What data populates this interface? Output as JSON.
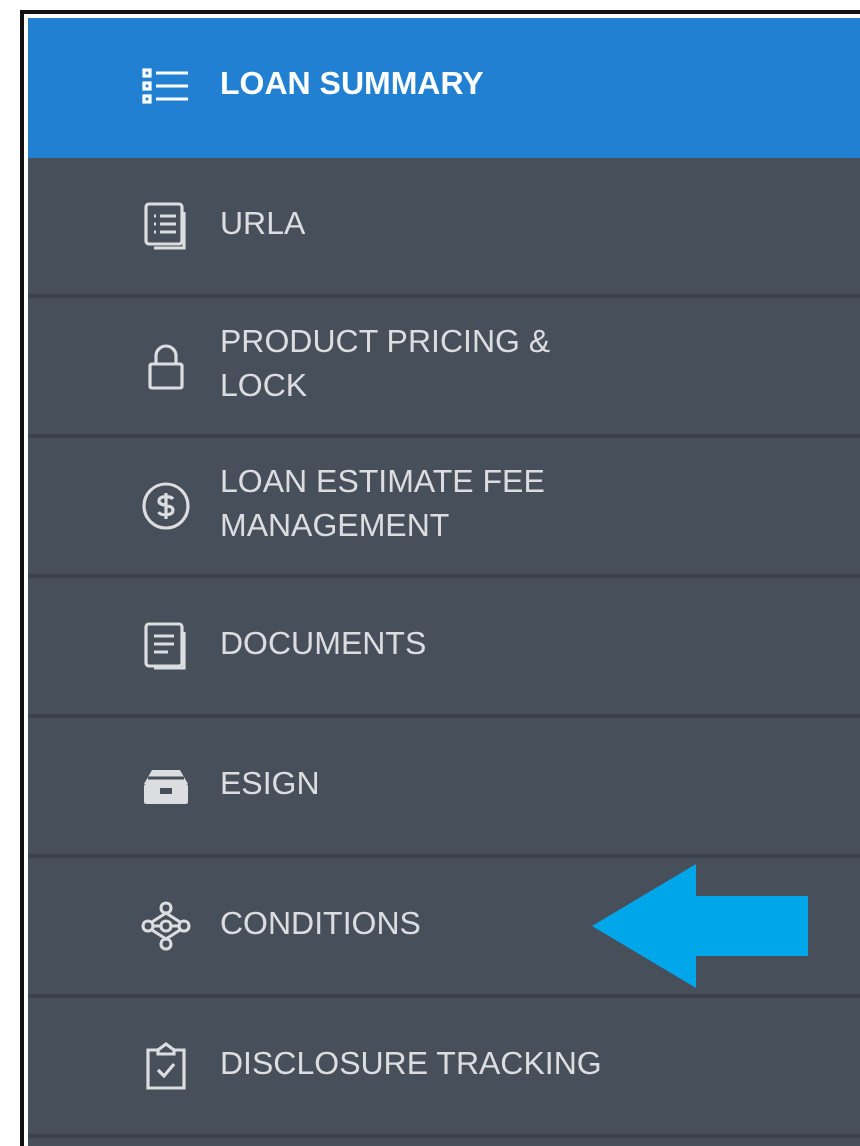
{
  "menu": [
    {
      "label": "LOAN SUMMARY",
      "selected": true,
      "pointed": false
    },
    {
      "label": "URLA",
      "selected": false,
      "pointed": false
    },
    {
      "label": "PRODUCT PRICING & LOCK",
      "selected": false,
      "pointed": false
    },
    {
      "label": "LOAN ESTIMATE FEE MANAGEMENT",
      "selected": false,
      "pointed": false
    },
    {
      "label": "DOCUMENTS",
      "selected": false,
      "pointed": false
    },
    {
      "label": "ESIGN",
      "selected": false,
      "pointed": false
    },
    {
      "label": "CONDITIONS",
      "selected": false,
      "pointed": true
    },
    {
      "label": "DISCLOSURE TRACKING",
      "selected": false,
      "pointed": false
    }
  ]
}
